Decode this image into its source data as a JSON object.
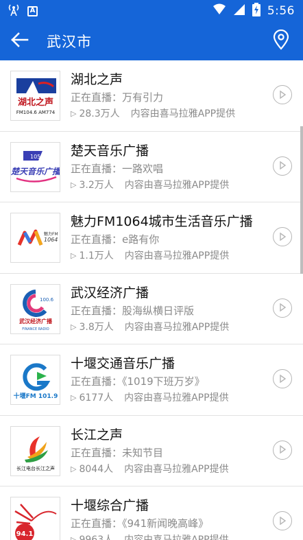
{
  "status_bar": {
    "time": "5:56",
    "a_icon_letter": "A"
  },
  "app_bar": {
    "title": "武汉市"
  },
  "stations": [
    {
      "name": "湖北之声",
      "live": "正在直播：万有引力",
      "count": "28.3万人",
      "provider": "内容由喜马拉雅APP提供",
      "logo_name": "hubei-zhisheng-logo"
    },
    {
      "name": "楚天音乐广播",
      "live": "正在直播：一路欢唱",
      "count": "3.2万人",
      "provider": "内容由喜马拉雅APP提供",
      "logo_name": "chutian-music-logo"
    },
    {
      "name": "魅力FM1064城市生活音乐广播",
      "live": "正在直播：e路有你",
      "count": "1.1万人",
      "provider": "内容由喜马拉雅APP提供",
      "logo_name": "meili-fm1064-logo"
    },
    {
      "name": "武汉经济广播",
      "live": "正在直播：股海纵横日评版",
      "count": "3.8万人",
      "provider": "内容由喜马拉雅APP提供",
      "logo_name": "wuhan-economy-logo"
    },
    {
      "name": "十堰交通音乐广播",
      "live": "正在直播：《1019下班万岁》",
      "count": "6177人",
      "provider": "内容由喜马拉雅APP提供",
      "logo_name": "shiyan-traffic-logo"
    },
    {
      "name": "长江之声",
      "live": "正在直播：未知节目",
      "count": "8044人",
      "provider": "内容由喜马拉雅APP提供",
      "logo_name": "changjiang-zhisheng-logo"
    },
    {
      "name": "十堰综合广播",
      "live": "正在直播：《941新闻晚高峰》",
      "count": "9963人",
      "provider": "内容由喜马拉雅APP提供",
      "logo_name": "shiyan-general-logo"
    }
  ],
  "logos": {
    "hubei_line1": "湖北之声",
    "hubei_line2": "FM104.6 AM774",
    "chutian_text": "楚天音乐广播",
    "chutian_freq": "105.8",
    "meili_text": "魅力FM",
    "meili_freq": "1064",
    "wuhan_text": "武汉经济广播",
    "wuhan_sub": "FINANCE RADIO",
    "wuhan_freq": "100.6",
    "shiyan_traffic_text": "十堰FM 101.9",
    "changjiang_text": "长江电台长江之声",
    "shiyan_general_freq": "94.1"
  },
  "colors": {
    "primary": "#1565d8",
    "divider": "#e2e2e2",
    "muted_text": "#8a8a8a"
  }
}
